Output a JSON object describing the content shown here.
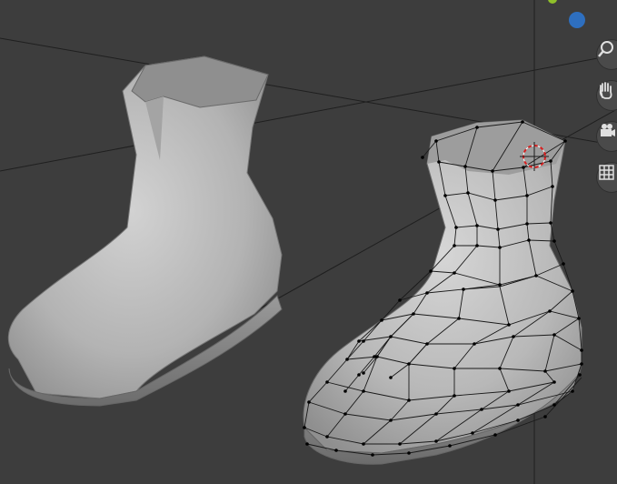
{
  "viewport": {
    "background": "#3d3d3d",
    "grid_line_color": "#1f1f1f",
    "mesh_color": "#b9b9b9",
    "wire_color": "#1a1a1a",
    "vertex_color": "#000000",
    "cursor_color": "#d61f1f"
  },
  "navigation_gizmo": {
    "y_axis_color": "#8fc02a",
    "z_axis_color": "#2e6fbf",
    "buttons": [
      {
        "icon": "zoom-icon"
      },
      {
        "icon": "pan-hand-icon"
      },
      {
        "icon": "camera-icon"
      },
      {
        "icon": "grid-icon"
      }
    ]
  }
}
